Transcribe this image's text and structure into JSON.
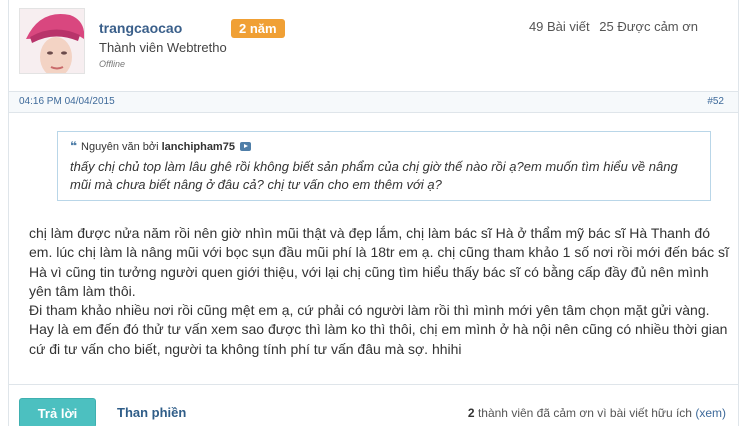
{
  "user": {
    "username": "trangcaocao",
    "badge": "2 năm",
    "rank": "Thành viên Webtretho",
    "status": "Offline",
    "stats": {
      "posts": "49 Bài viết",
      "thanks": "25 Được cảm ơn"
    }
  },
  "meta": {
    "date": "04:16 PM 04/04/2015",
    "post_number": "#52"
  },
  "quote": {
    "prefix": "Nguyên văn bởi",
    "author": "lanchipham75",
    "text": "thấy chị chủ top làm lâu ghê rồi không biết sản phẩm của chị giờ thế nào rồi ạ?em muốn tìm hiểu về nâng mũi mà chưa biết nâng ở đâu cả? chị tư vấn cho em thêm với ạ?"
  },
  "message": "chị làm được nửa năm rồi nên giờ nhìn mũi thật và đẹp lắm, chị làm bác sĩ Hà ở thẩm mỹ bác sĩ Hà Thanh đó em. lúc chị làm là nâng mũi với bọc sụn đầu mũi phí là 18tr em ạ. chị cũng tham khảo 1 số nơi rồi mới đến bác sĩ Hà vì cũng tin tưởng người quen giới thiệu, với lại chị cũng tìm hiểu thấy bác sĩ có bằng cấp đầy đủ nên mình yên tâm làm thôi.\nĐi tham khảo nhiều nơi rồi cũng mệt em ạ, cứ phải có người làm rồi thì mình mới yên tâm chọn mặt gửi vàng. Hay là em đến đó thử tư vấn xem sao được thì làm ko thì thôi, chị em mình ở hà nội nên cũng có nhiều thời gian cứ đi tư vấn cho biết, người ta không tính phí tư vấn đâu mà sợ. hhihi",
  "footer": {
    "reply_label": "Trả lời",
    "complain_label": "Than phiền",
    "thanks_count": "2",
    "thanks_text": "thành viên đã cảm ơn vì bài viết hữu ích",
    "thanks_link": "(xem)"
  },
  "colors": {
    "accent": "#4cc0c0",
    "badge": "#f0a035",
    "link": "#3e6a9a",
    "quote_border": "#b9d6e8"
  }
}
